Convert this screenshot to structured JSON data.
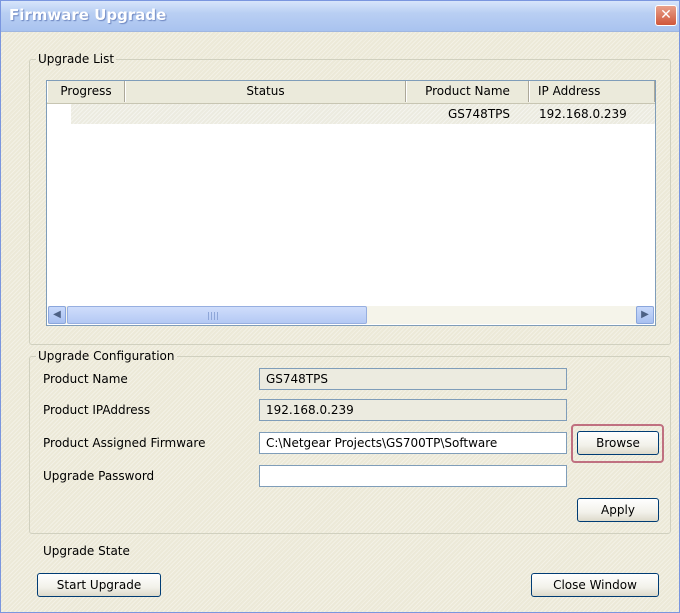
{
  "window": {
    "title": "Firmware Upgrade",
    "close_glyph": "✕"
  },
  "upgrade_list": {
    "legend": "Upgrade List",
    "columns": [
      "Progress",
      "Status",
      "Product Name",
      "IP Address"
    ],
    "rows": [
      {
        "progress": "",
        "status": "",
        "product_name": "GS748TPS",
        "ip_address": "192.168.0.239"
      }
    ],
    "scroll_left": "◀",
    "scroll_right": "▶"
  },
  "config": {
    "legend": "Upgrade Configuration",
    "product_name_label": "Product Name",
    "product_name_value": "GS748TPS",
    "product_ip_label": "Product IPAddress",
    "product_ip_value": "192.168.0.239",
    "firmware_label": "Product Assigned Firmware",
    "firmware_value": "C:\\Netgear Projects\\GS700TP\\Software",
    "password_label": "Upgrade Password",
    "password_value": "",
    "browse_label": "Browse",
    "apply_label": "Apply"
  },
  "footer": {
    "state_label": "Upgrade State",
    "start_label": "Start Upgrade",
    "close_label": "Close Window"
  }
}
